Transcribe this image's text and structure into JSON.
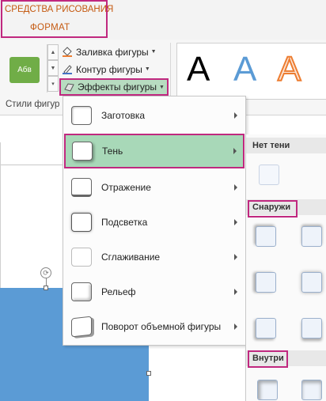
{
  "context": {
    "title": "СРЕДСТВА РИСОВАНИЯ",
    "tab": "ФОРМАТ"
  },
  "ribbon": {
    "style_thumb_label": "Абв",
    "fill_label": "Заливка фигуры",
    "outline_label": "Контур фигуры",
    "effects_label": "Эффекты фигуры",
    "group_label": "Стили фигур",
    "wordart": [
      "A",
      "A",
      "A"
    ]
  },
  "menu": {
    "items": [
      {
        "label": "Заготовка"
      },
      {
        "label": "Тень"
      },
      {
        "label": "Отражение"
      },
      {
        "label": "Подсветка"
      },
      {
        "label": "Сглаживание"
      },
      {
        "label": "Рельеф"
      },
      {
        "label": "Поворот объемной фигуры"
      }
    ]
  },
  "submenu": {
    "no_shadow": "Нет тени",
    "outer": "Снаружи",
    "inner": "Внутри"
  },
  "colors": {
    "highlight_border": "#c0287f",
    "selected_item": "#a8d8b8",
    "accent_orange": "#c55a11",
    "shape_blue": "#5b9bd5",
    "thumb_green": "#70ad47"
  },
  "icons": [
    "paint-bucket-icon",
    "pen-outline-icon",
    "shape-effects-icon",
    "rotate-handle-icon",
    "submenu-arrow-icon"
  ]
}
